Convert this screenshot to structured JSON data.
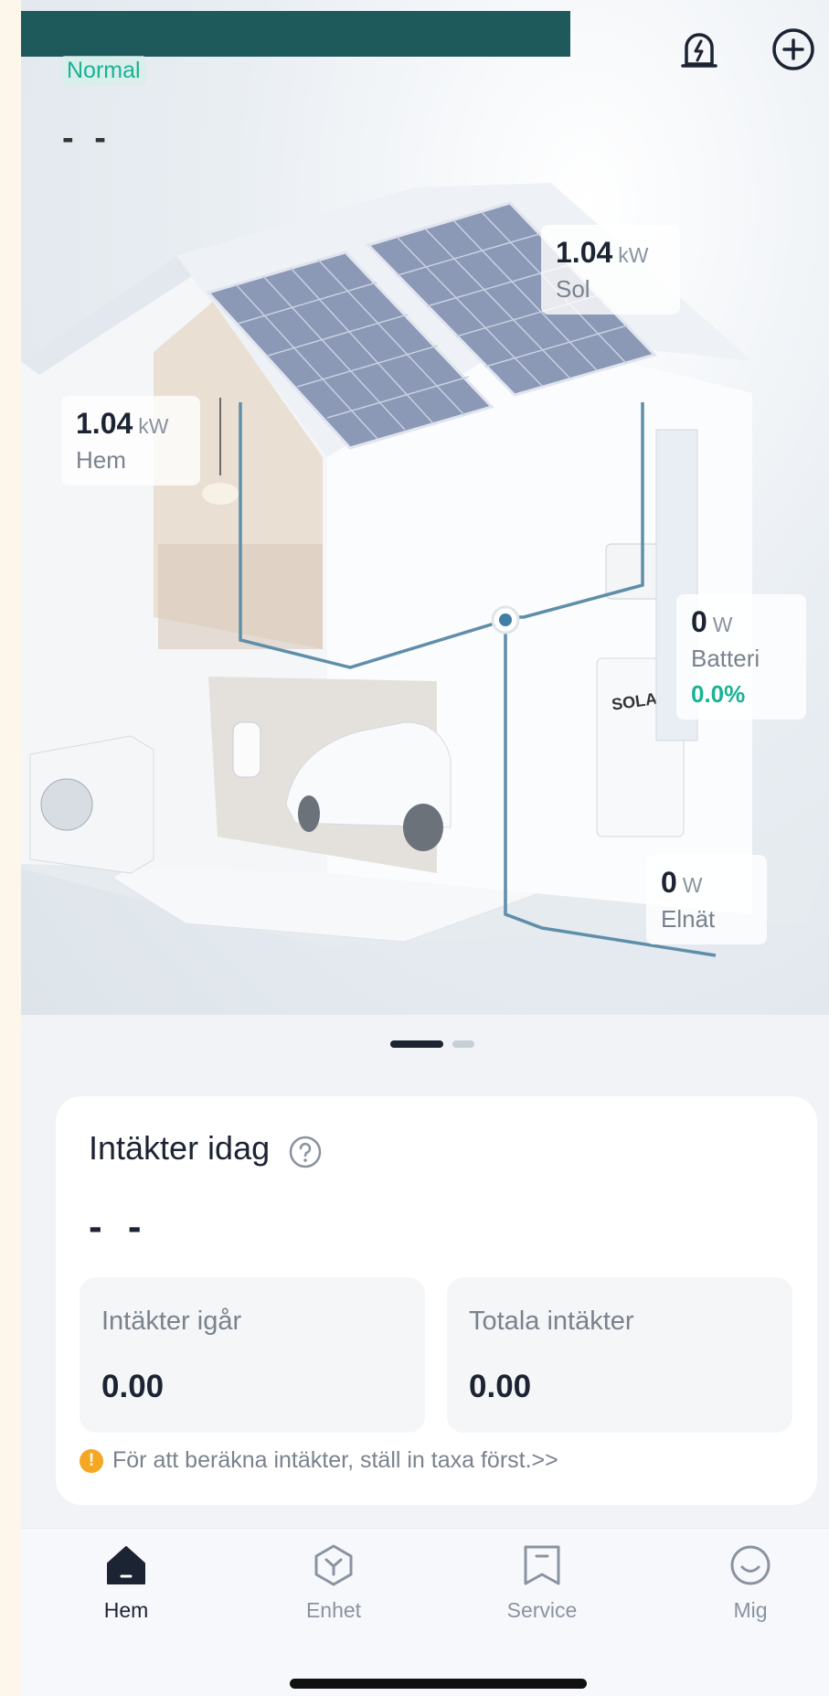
{
  "header": {
    "status": "Normal",
    "value": "- -"
  },
  "flow": {
    "sol": {
      "value": "1.04",
      "unit": "kW",
      "label": "Sol"
    },
    "hem": {
      "value": "1.04",
      "unit": "kW",
      "label": "Hem"
    },
    "batteri": {
      "value": "0",
      "unit": "W",
      "label": "Batteri",
      "soc": "0.0%"
    },
    "elnat": {
      "value": "0",
      "unit": "W",
      "label": "Elnät"
    },
    "brand_label": "SOLAX"
  },
  "income": {
    "title": "Intäkter idag",
    "today": "- -",
    "yesterday_label": "Intäkter igår",
    "yesterday_value": "0.00",
    "total_label": "Totala intäkter",
    "total_value": "0.00",
    "notice": "För att beräkna intäkter, ställ in taxa först.>>"
  },
  "tabs": [
    {
      "label": "Hem",
      "icon": "home-icon",
      "active": true
    },
    {
      "label": "Enhet",
      "icon": "device-icon",
      "active": false
    },
    {
      "label": "Service",
      "icon": "bookmark-icon",
      "active": false
    },
    {
      "label": "Mig",
      "icon": "smile-icon",
      "active": false
    }
  ],
  "colors": {
    "accent": "#19b394",
    "dark": "#1c2333",
    "warning": "#f5a623",
    "redaction": "#1e5a5b"
  }
}
